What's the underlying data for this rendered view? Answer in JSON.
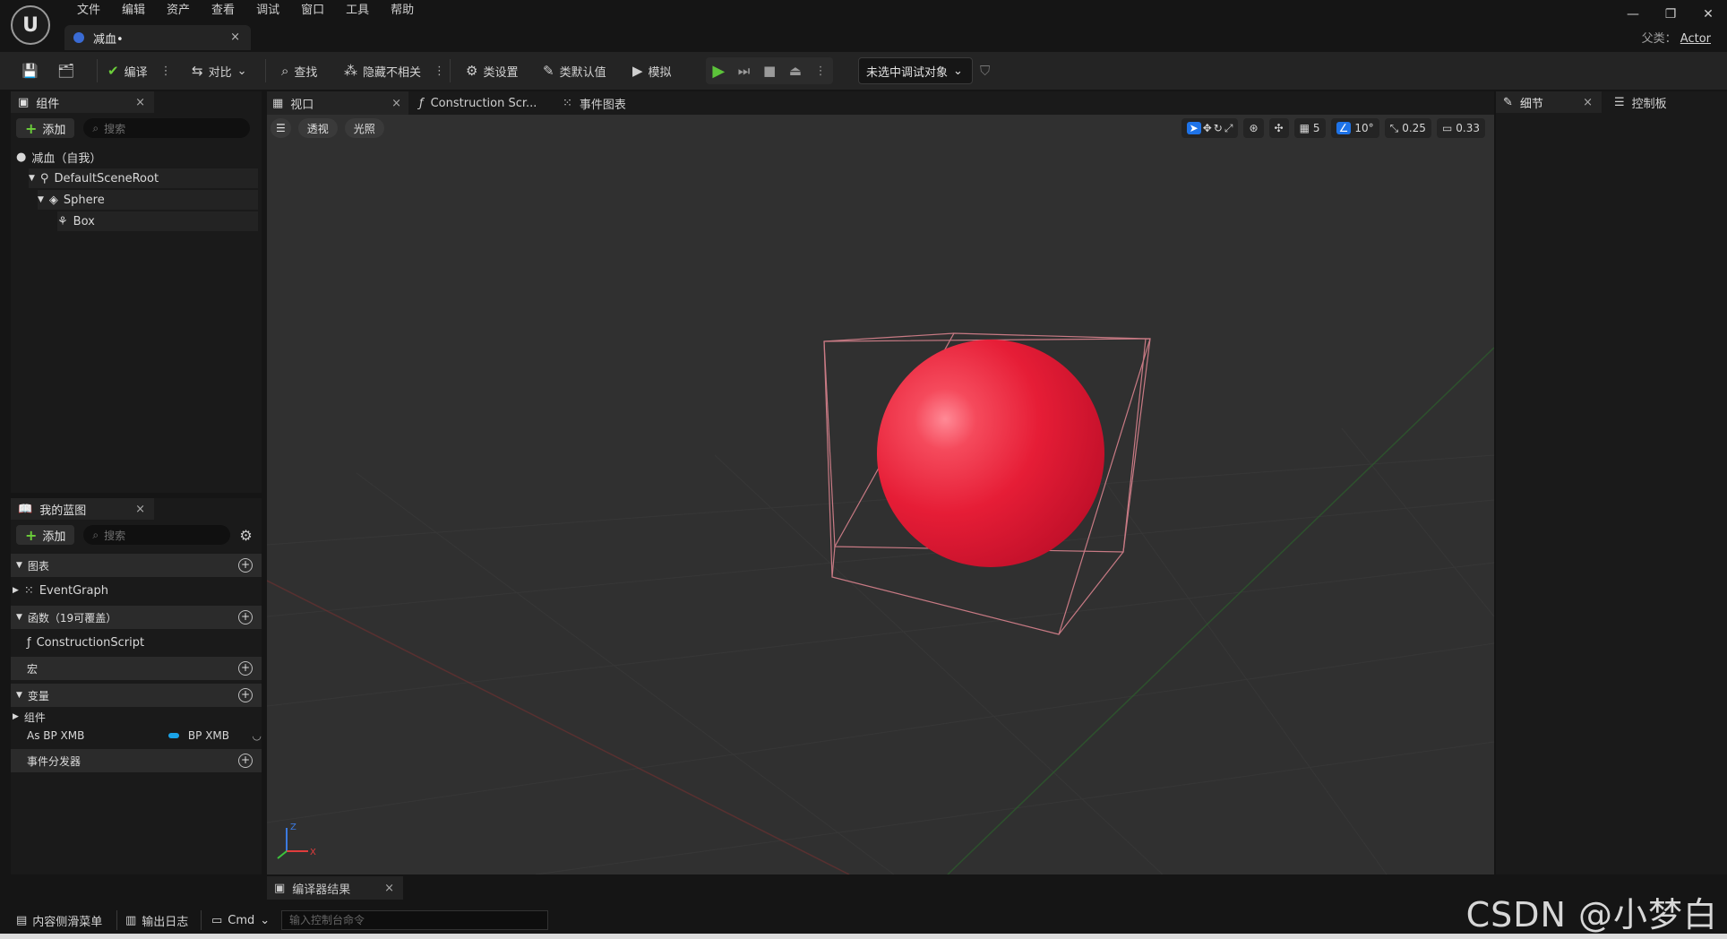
{
  "menu": [
    "文件",
    "编辑",
    "资产",
    "查看",
    "调试",
    "窗口",
    "工具",
    "帮助"
  ],
  "doc_tab": {
    "name": "减血•",
    "close": "×"
  },
  "window": {
    "minimize": "—",
    "restore": "❐",
    "close": "✕"
  },
  "parent": {
    "label": "父类：",
    "value": "Actor"
  },
  "toolbar": {
    "compile": "编译",
    "diff": "对比",
    "find": "查找",
    "hide_unrelated": "隐藏不相关",
    "class_settings": "类设置",
    "class_defaults": "类默认值",
    "simulate": "模拟",
    "debug_object": "未选中调试对象"
  },
  "components_panel": {
    "title": "组件",
    "add": "添加",
    "search_placeholder": "搜索",
    "tree": [
      "减血（自我）",
      "DefaultSceneRoot",
      "Sphere",
      "Box"
    ]
  },
  "my_blueprint": {
    "title": "我的蓝图",
    "add": "添加",
    "search_placeholder": "搜索",
    "sections": {
      "graphs": "图表",
      "event_graph": "EventGraph",
      "functions": "函数（19可覆盖）",
      "construction_script": "ConstructionScript",
      "macros": "宏",
      "variables": "变量",
      "components": "组件",
      "var_name": "As BP XMB",
      "var_type": "BP XMB",
      "dispatchers": "事件分发器"
    }
  },
  "viewport_tabs": {
    "viewport": "视口",
    "construction": "Construction Scr...",
    "event_graph": "事件图表"
  },
  "viewport": {
    "perspective": "透视",
    "lit": "光照",
    "grid_size": "5",
    "rotation_snap": "10°",
    "scale_snap": "0.25",
    "camera_speed": "0.33",
    "axis_z": "Z",
    "axis_x": "X"
  },
  "right_panel": {
    "details": "细节",
    "palette": "控制板"
  },
  "bottom": {
    "compiler_results": "编译器结果",
    "content_drawer": "内容侧滑菜单",
    "output_log": "输出日志",
    "cmd": "Cmd",
    "console_placeholder": "输入控制台命令",
    "watermark": "CSDN @小梦白"
  },
  "colors": {
    "sphere": "#e8213a",
    "accent": "#1e73e8",
    "play": "#5cc43a",
    "add_plus": "#6ccf3a"
  }
}
